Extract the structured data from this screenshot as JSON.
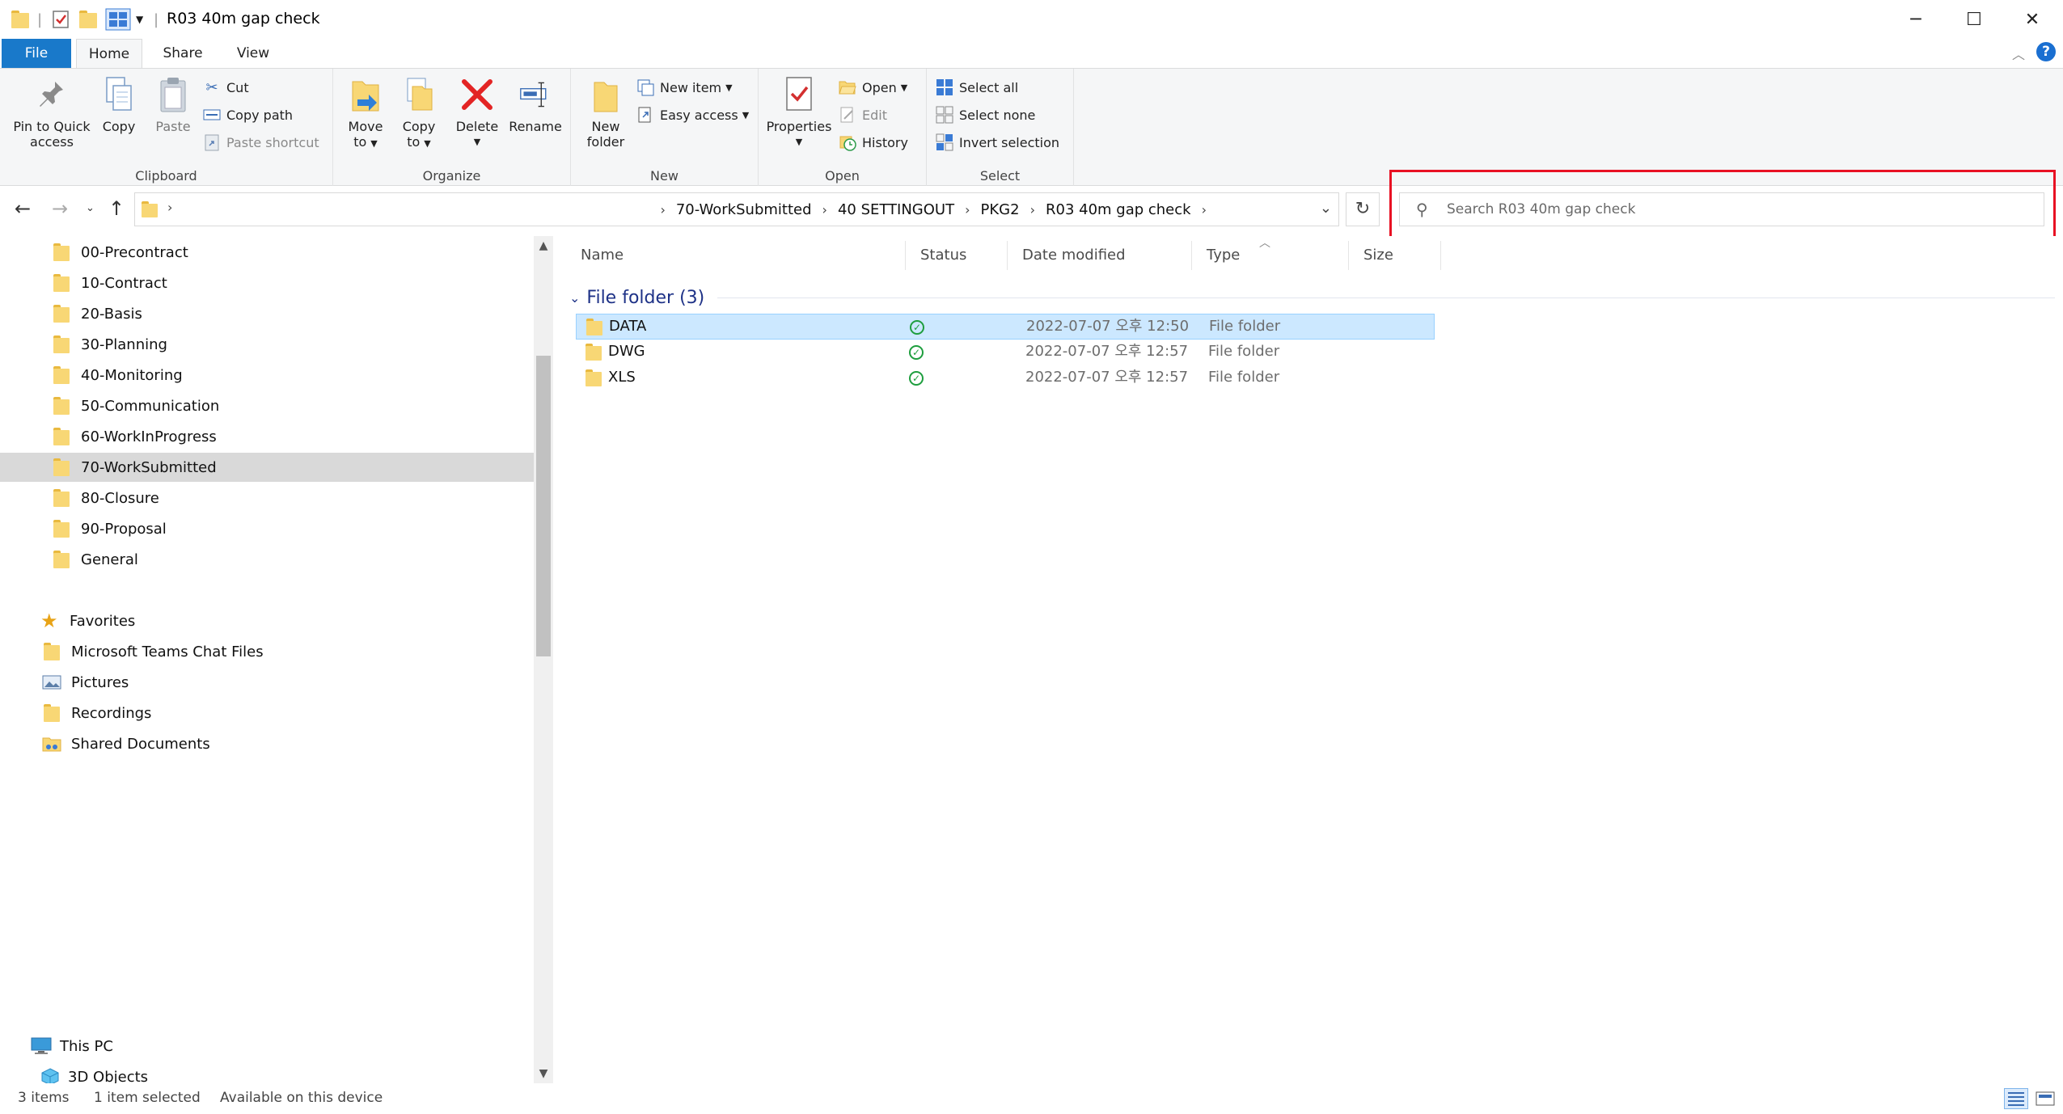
{
  "window": {
    "title": "R03 40m gap check",
    "minimize": "─",
    "maximize": "☐",
    "close": "✕"
  },
  "ribbon_tabs": [
    {
      "label": "File"
    },
    {
      "label": "Home"
    },
    {
      "label": "Share"
    },
    {
      "label": "View"
    }
  ],
  "help": "?",
  "ribbon": {
    "clipboard": {
      "label": "Clipboard",
      "pin_line1": "Pin to Quick",
      "pin_line2": "access",
      "copy": "Copy",
      "paste": "Paste",
      "cut": "Cut",
      "copy_path": "Copy path",
      "paste_shortcut": "Paste shortcut"
    },
    "organize": {
      "label": "Organize",
      "move_line1": "Move",
      "move_line2": "to",
      "copy_line1": "Copy",
      "copy_line2": "to",
      "delete": "Delete",
      "rename": "Rename"
    },
    "new": {
      "label": "New",
      "new_folder_line1": "New",
      "new_folder_line2": "folder",
      "new_item": "New item",
      "easy_access": "Easy access"
    },
    "open": {
      "label": "Open",
      "properties": "Properties",
      "open": "Open",
      "edit": "Edit",
      "history": "History"
    },
    "select": {
      "label": "Select",
      "select_all": "Select all",
      "select_none": "Select none",
      "invert_selection": "Invert selection"
    }
  },
  "address": {
    "breadcrumbs": [
      "70-WorkSubmitted",
      "40 SETTINGOUT",
      "PKG2",
      "R03 40m gap check"
    ],
    "search_placeholder": "Search R03 40m gap check"
  },
  "nav_pane": {
    "folders": [
      {
        "label": "00-Precontract"
      },
      {
        "label": "10-Contract"
      },
      {
        "label": "20-Basis"
      },
      {
        "label": "30-Planning"
      },
      {
        "label": "40-Monitoring"
      },
      {
        "label": "50-Communication"
      },
      {
        "label": "60-WorkInProgress"
      },
      {
        "label": "70-WorkSubmitted",
        "selected": true
      },
      {
        "label": "80-Closure"
      },
      {
        "label": "90-Proposal"
      },
      {
        "label": "General"
      }
    ],
    "quick": [
      {
        "label": "Favorites",
        "icon": "star-icon"
      },
      {
        "label": "Microsoft Teams Chat Files",
        "icon": "folder-icon"
      },
      {
        "label": "Pictures",
        "icon": "pictures-icon"
      },
      {
        "label": "Recordings",
        "icon": "folder-icon"
      },
      {
        "label": "Shared Documents",
        "icon": "shared-folder-icon"
      }
    ],
    "this_pc": "This PC",
    "objects_3d": "3D Objects"
  },
  "file_list": {
    "columns": [
      "Name",
      "Status",
      "Date modified",
      "Type",
      "Size"
    ],
    "group_label": "File folder (3)",
    "rows": [
      {
        "name": "DATA",
        "status": "synced",
        "date": "2022-07-07 오후 12:50",
        "type": "File folder",
        "size": "",
        "selected": true
      },
      {
        "name": "DWG",
        "status": "synced",
        "date": "2022-07-07 오후 12:57",
        "type": "File folder",
        "size": "",
        "selected": false
      },
      {
        "name": "XLS",
        "status": "synced",
        "date": "2022-07-07 오후 12:57",
        "type": "File folder",
        "size": "",
        "selected": false
      }
    ]
  },
  "status_bar": {
    "item_count": "3 items",
    "selected": "1 item selected",
    "availability": "Available on this device"
  },
  "colors": {
    "file_tab": "#1979ca",
    "selection": "#cce8ff",
    "highlight_box": "#e81123",
    "group_header": "#1e3287",
    "folder_yellow": "#f8d775"
  }
}
